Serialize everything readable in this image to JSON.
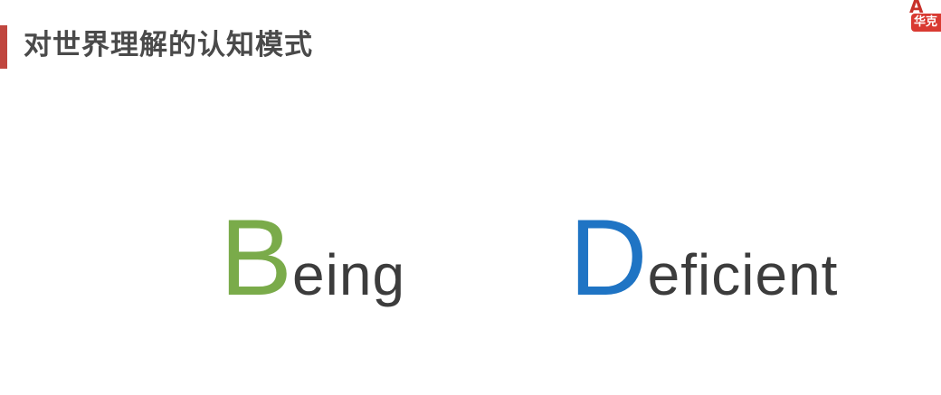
{
  "header": {
    "title": "对世界理解的认知模式",
    "accent_color": "#c0463f"
  },
  "logo": {
    "top_text": "A",
    "bottom_text": "华克"
  },
  "words": [
    {
      "initial": "B",
      "rest": "eing",
      "initial_color": "#7aab4a",
      "rest_color": "#3c3c3c"
    },
    {
      "initial": "D",
      "rest": "eficient",
      "initial_color": "#1f74c4",
      "rest_color": "#3c3c3c"
    }
  ]
}
